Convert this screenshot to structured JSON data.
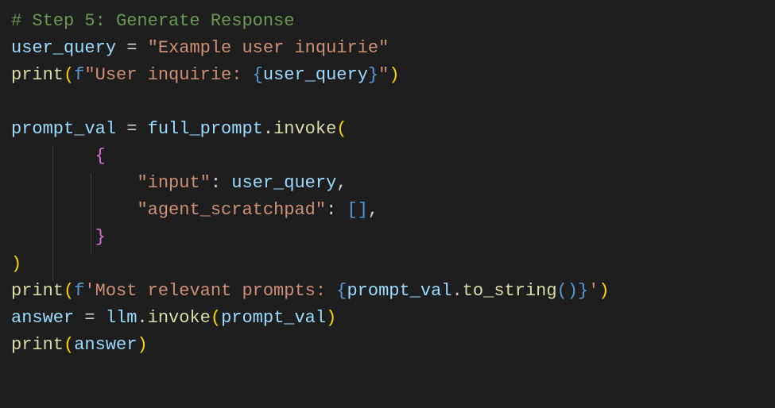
{
  "code": {
    "comment": "# Step 5: Generate Response",
    "assign1": {
      "var": "user_query",
      "eq": " = ",
      "string": "\"Example user inquirie\""
    },
    "print1": {
      "fn": "print",
      "open": "(",
      "f": "f",
      "qopen": "\"",
      "lit1": "User inquirie: ",
      "lb": "{",
      "var": "user_query",
      "rb": "}",
      "qclose": "\"",
      "close": ")"
    },
    "assign2": {
      "var": "prompt_val",
      "eq": " = ",
      "obj": "full_prompt",
      "dot": ".",
      "method": "invoke",
      "open": "("
    },
    "dict": {
      "indent1": "        ",
      "open": "{",
      "indent2": "            ",
      "key1": "\"input\"",
      "colon": ": ",
      "val1": "user_query",
      "comma": ",",
      "key2": "\"agent_scratchpad\"",
      "val2open": "[",
      "val2close": "]",
      "close": "}"
    },
    "closeparen": ")",
    "print2": {
      "fn": "print",
      "open": "(",
      "f": "f",
      "qopen": "'",
      "lit1": "Most relevant prompts: ",
      "lb": "{",
      "obj": "prompt_val",
      "dot": ".",
      "method": "to_string",
      "iopen": "(",
      "iclose": ")",
      "rb": "}",
      "qclose": "'",
      "close": ")"
    },
    "assign3": {
      "var": "answer",
      "eq": " = ",
      "obj": "llm",
      "dot": ".",
      "method": "invoke",
      "open": "(",
      "arg": "prompt_val",
      "close": ")"
    },
    "print3": {
      "fn": "print",
      "open": "(",
      "arg": "answer",
      "close": ")"
    }
  }
}
